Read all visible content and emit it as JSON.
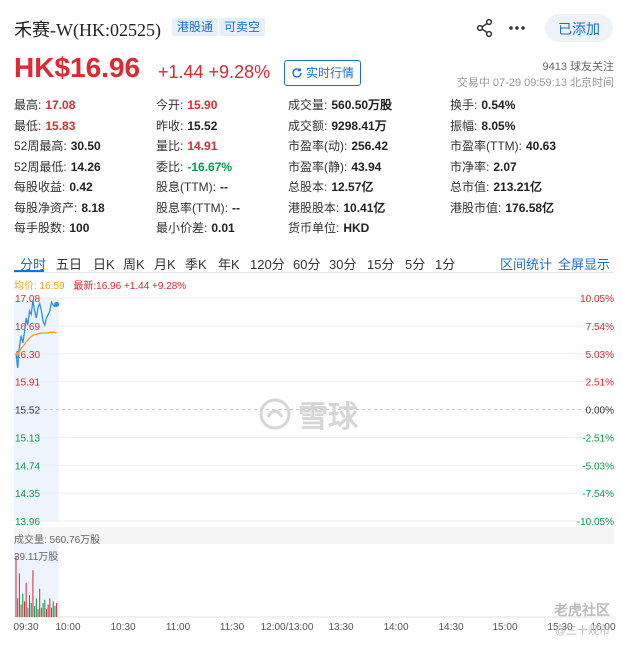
{
  "header": {
    "name": "禾赛-W(HK:02525)",
    "tags": [
      "港股通",
      "可卖空"
    ],
    "added_label": "已添加"
  },
  "quote": {
    "price": "HK$16.96",
    "change": "+1.44 +9.28%",
    "realtime_label": "实时行情",
    "followers": "9413 球友关注",
    "trade_info": "交易中 07-29 09:59:13 北京时间"
  },
  "stats": [
    [
      {
        "label": "最高:",
        "value": "17.08",
        "tone": "up"
      },
      {
        "label": "今开:",
        "value": "15.90",
        "tone": "up"
      },
      {
        "label": "成交量:",
        "value": "560.50万股",
        "tone": ""
      },
      {
        "label": "换手:",
        "value": "0.54%",
        "tone": ""
      }
    ],
    [
      {
        "label": "最低:",
        "value": "15.83",
        "tone": "up"
      },
      {
        "label": "昨收:",
        "value": "15.52",
        "tone": ""
      },
      {
        "label": "成交额:",
        "value": "9298.41万",
        "tone": ""
      },
      {
        "label": "振幅:",
        "value": "8.05%",
        "tone": ""
      }
    ],
    [
      {
        "label": "52周最高:",
        "value": "30.50",
        "tone": ""
      },
      {
        "label": "量比:",
        "value": "14.91",
        "tone": "up"
      },
      {
        "label": "市盈率(动):",
        "value": "256.42",
        "tone": ""
      },
      {
        "label": "市盈率(TTM):",
        "value": "40.63",
        "tone": ""
      }
    ],
    [
      {
        "label": "52周最低:",
        "value": "14.26",
        "tone": ""
      },
      {
        "label": "委比:",
        "value": "-16.67%",
        "tone": "down"
      },
      {
        "label": "市盈率(静):",
        "value": "43.94",
        "tone": ""
      },
      {
        "label": "市净率:",
        "value": "2.07",
        "tone": ""
      }
    ],
    [
      {
        "label": "每股收益:",
        "value": "0.42",
        "tone": ""
      },
      {
        "label": "股息(TTM):",
        "value": "--",
        "tone": ""
      },
      {
        "label": "总股本:",
        "value": "12.57亿",
        "tone": ""
      },
      {
        "label": "总市值:",
        "value": "213.21亿",
        "tone": ""
      }
    ],
    [
      {
        "label": "每股净资产:",
        "value": "8.18",
        "tone": ""
      },
      {
        "label": "股息率(TTM):",
        "value": "--",
        "tone": ""
      },
      {
        "label": "港股股本:",
        "value": "10.41亿",
        "tone": ""
      },
      {
        "label": "港股市值:",
        "value": "176.58亿",
        "tone": ""
      }
    ],
    [
      {
        "label": "每手股数:",
        "value": "100",
        "tone": ""
      },
      {
        "label": "最小价差:",
        "value": "0.01",
        "tone": ""
      },
      {
        "label": "货币单位:",
        "value": "HKD",
        "tone": ""
      },
      null
    ]
  ],
  "tabs": [
    "分时",
    "五日",
    "日K",
    "周K",
    "月K",
    "季K",
    "年K",
    "120分",
    "60分",
    "30分",
    "15分",
    "5分",
    "1分"
  ],
  "tabs_right": [
    "区间统计",
    "全屏显示"
  ],
  "legend": {
    "avg": "均价: 16.59",
    "latest": "最新:16.96 +1.44 +9.28%"
  },
  "watermark": "雪球",
  "volume": {
    "label": "成交量: 560.76万股",
    "max_label": "39.11万股"
  },
  "footer": {
    "brand": "老虎社区",
    "sub": "@三十观市"
  },
  "colors": {
    "up": "#e0282f",
    "down": "#0a9a4b",
    "accent": "#1a6fd6",
    "avg": "#f0a020",
    "price": "#2f8ee0"
  },
  "chart_data": {
    "type": "line",
    "price_ticks": [
      "17.08",
      "16.69",
      "16.30",
      "15.91",
      "15.52",
      "15.13",
      "14.74",
      "14.35",
      "13.96"
    ],
    "pct_ticks": [
      "10.05%",
      "7.54%",
      "5.03%",
      "2.51%",
      "0.00%",
      "-2.51%",
      "-5.03%",
      "-7.54%",
      "-10.05%"
    ],
    "time_ticks": [
      "09:30",
      "10:00",
      "10:30",
      "11:00",
      "11:30",
      "12:00/13:00",
      "13:30",
      "14:00",
      "14:30",
      "15:00",
      "15:30",
      "16:00"
    ],
    "ylim": [
      13.96,
      17.08
    ],
    "prev_close": 15.52,
    "series": [
      {
        "name": "价格",
        "values": [
          16.3,
          16.1,
          16.4,
          16.55,
          16.45,
          16.6,
          16.8,
          16.7,
          16.9,
          16.85,
          17.05,
          16.9,
          16.8,
          16.95,
          17.0,
          16.9,
          16.75,
          16.7,
          16.8,
          16.85,
          16.9,
          17.02,
          16.98,
          16.96,
          16.99
        ]
      },
      {
        "name": "均价",
        "values": [
          16.3,
          16.28,
          16.33,
          16.38,
          16.4,
          16.43,
          16.47,
          16.49,
          16.52,
          16.54,
          16.56,
          16.57,
          16.57,
          16.58,
          16.58,
          16.59,
          16.59,
          16.59,
          16.59,
          16.59,
          16.6,
          16.6,
          16.6,
          16.6,
          16.59
        ]
      }
    ],
    "volume": [
      39.1,
      12,
      28,
      8,
      15,
      10,
      22,
      6,
      14,
      9,
      30,
      7,
      12,
      5,
      18,
      6,
      9,
      11,
      5,
      8,
      12,
      6,
      10,
      7,
      9
    ],
    "volume_max": 39.11
  }
}
